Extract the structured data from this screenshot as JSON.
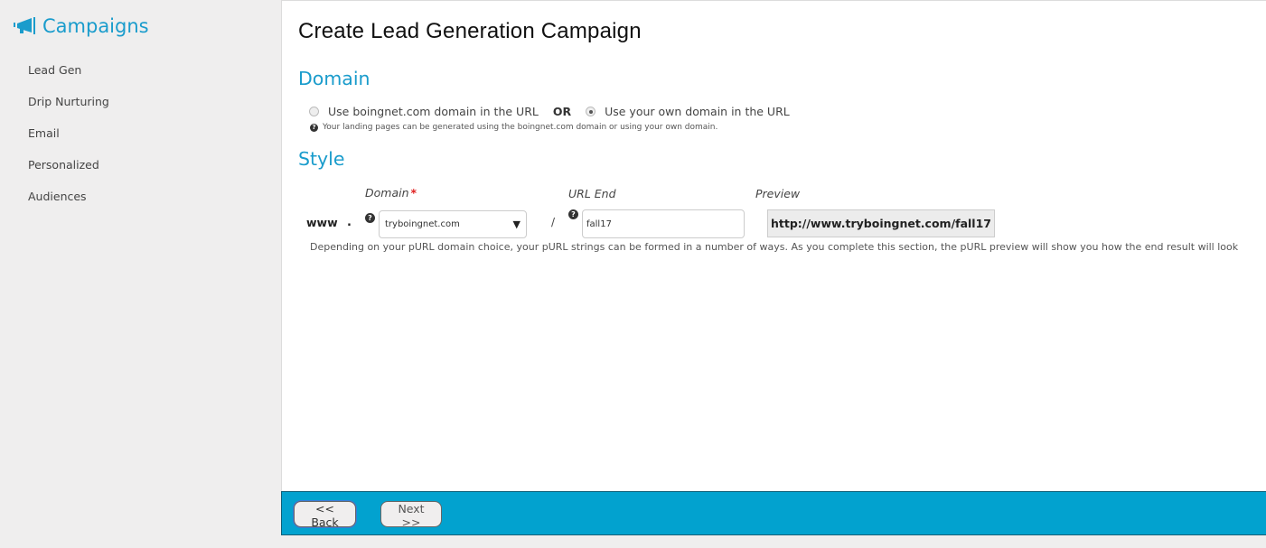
{
  "sidebar": {
    "title": "Campaigns",
    "icon": "megaphone-icon",
    "items": [
      {
        "label": "Lead Gen"
      },
      {
        "label": "Drip Nurturing"
      },
      {
        "label": "Email"
      },
      {
        "label": "Personalized"
      },
      {
        "label": "Audiences"
      }
    ]
  },
  "main": {
    "title": "Create Lead Generation Campaign",
    "domain_section": {
      "heading": "Domain",
      "option_boingnet": "Use boingnet.com domain in the URL",
      "or_label": "OR",
      "option_own": "Use your own domain in the URL",
      "selected": "own",
      "help_text": "Your landing pages can be generated using the boingnet.com domain or using your own domain."
    },
    "style_section": {
      "heading": "Style",
      "www_label": "www",
      "dot_label": ".",
      "slash_label": "/",
      "domain_label": "Domain",
      "required_mark": "*",
      "domain_value": "tryboingnet.com",
      "url_end_label": "URL End",
      "url_end_value": "fall17",
      "preview_label": "Preview",
      "preview_value": "http://www.tryboingnet.com/fall17",
      "description": "Depending on your pURL domain choice, your pURL strings can be formed in a number of ways. As you complete this section, the pURL preview will show you how the end result will look"
    }
  },
  "footer": {
    "back_label": "<< Back",
    "next_label": "Next >>"
  },
  "colors": {
    "accent": "#1a9ccc",
    "footer_bar": "#02a2cf",
    "required": "#e02020"
  }
}
